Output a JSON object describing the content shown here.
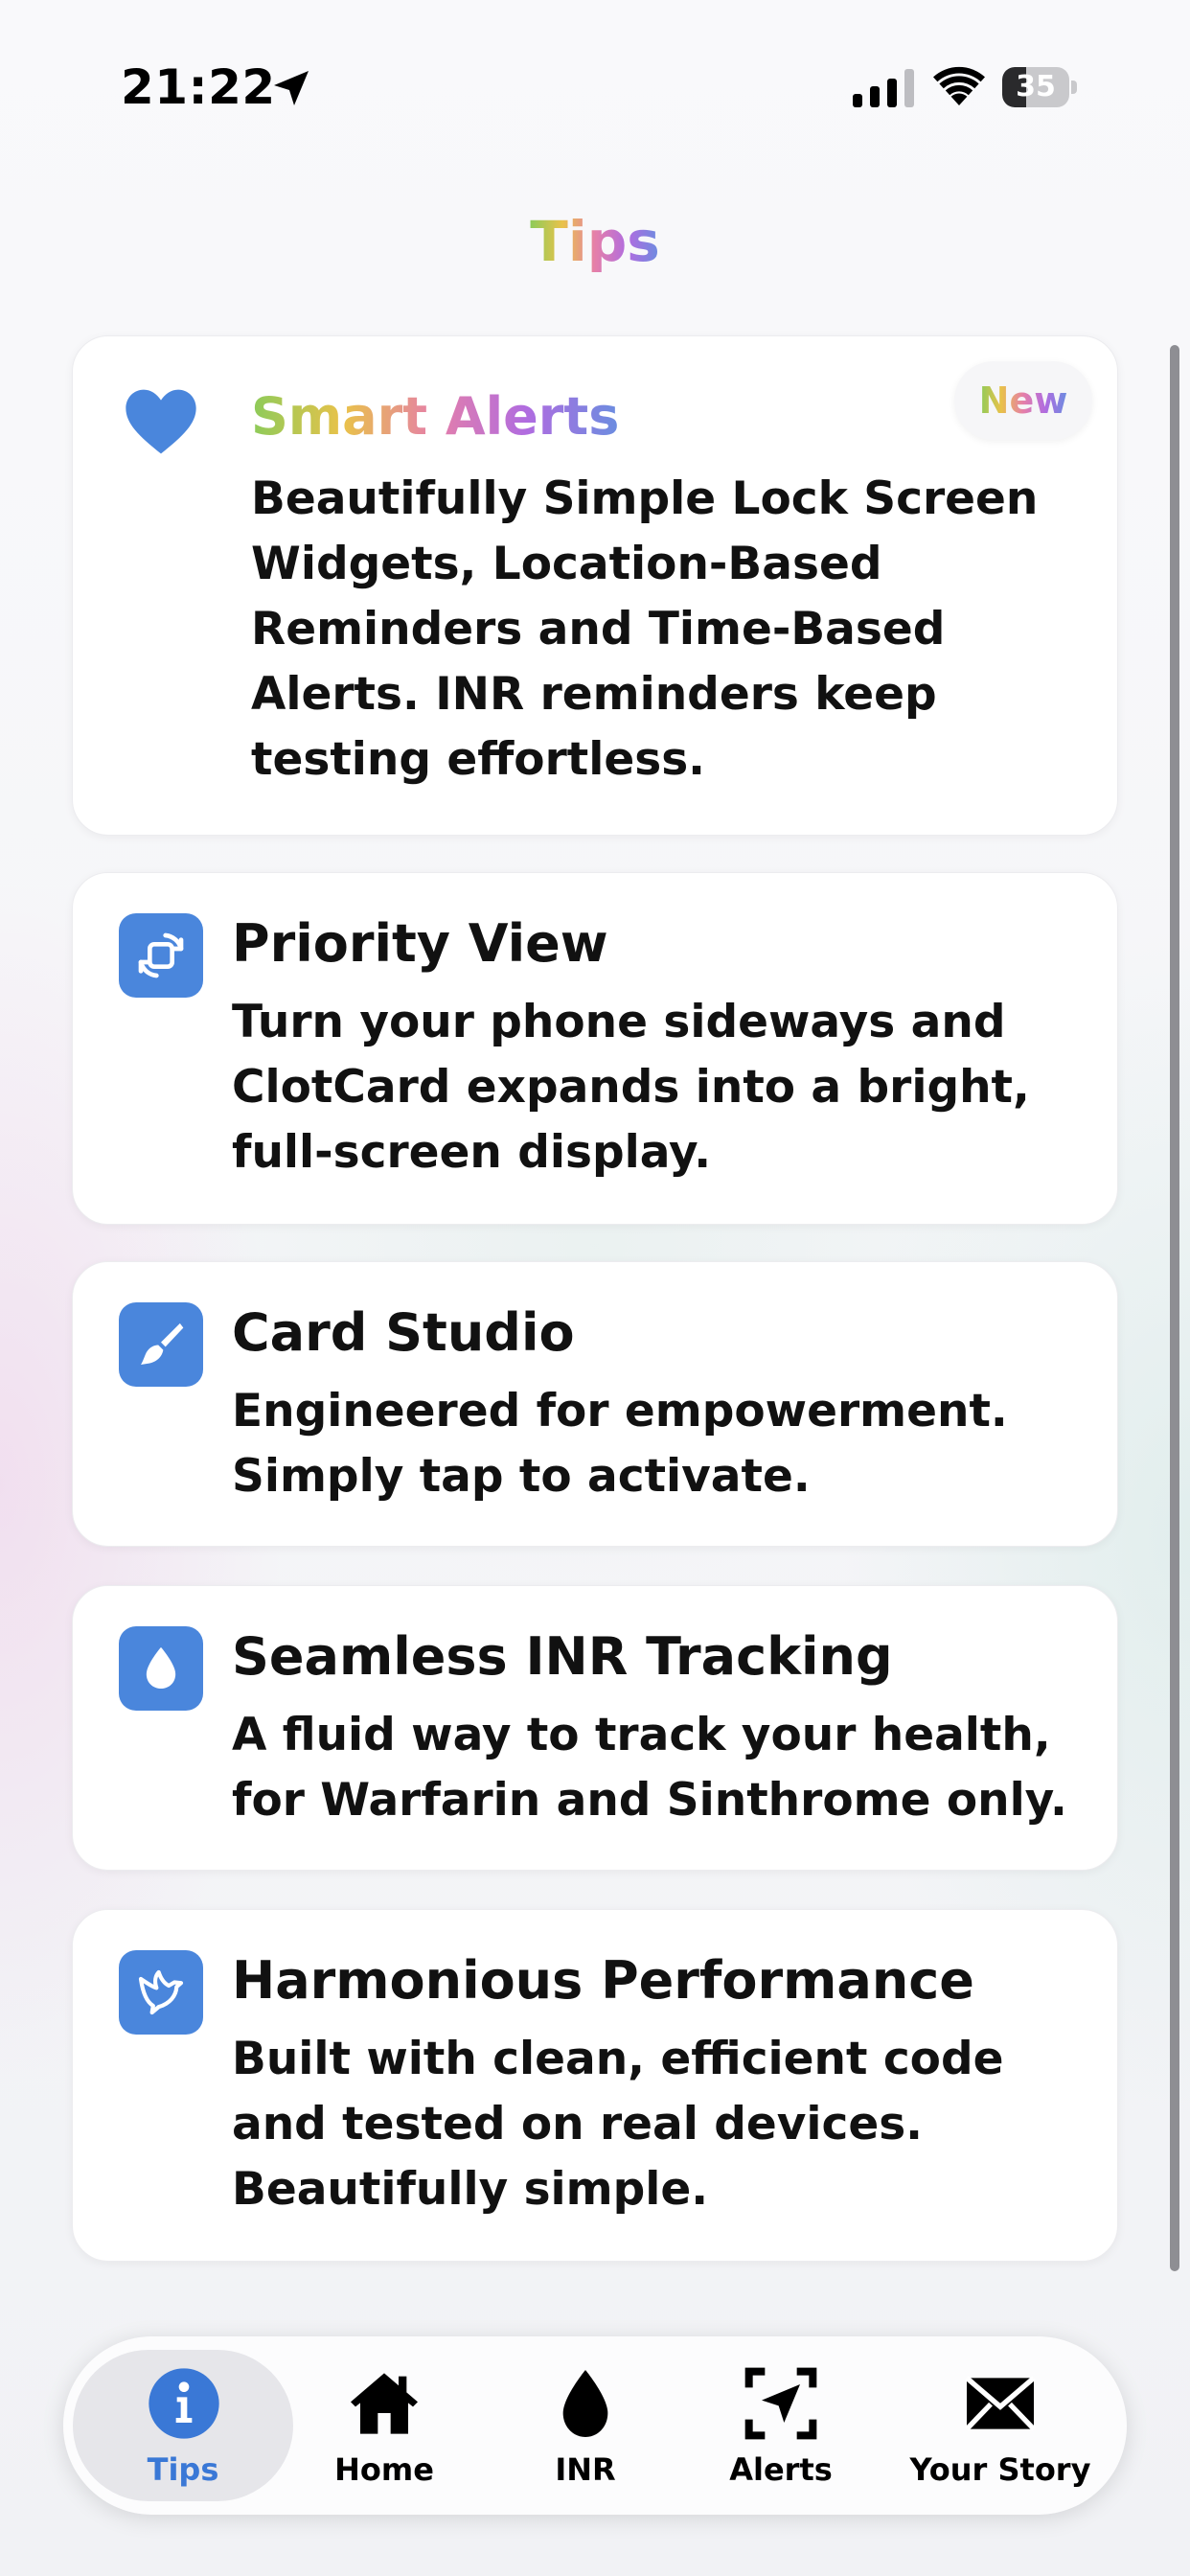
{
  "status_bar": {
    "time": "21:22",
    "battery": "35",
    "battery_level": 35
  },
  "header": {
    "title": "Tips"
  },
  "cards": [
    {
      "title": "Smart Alerts",
      "badge": "New",
      "icon": "heart-icon",
      "body": "Beautifully Simple Lock Screen Widgets, Location-Based Reminders and Time-Based Alerts. INR reminders keep testing effortless."
    },
    {
      "title": "Priority View",
      "icon": "rotate-icon",
      "body": "Turn your phone sideways and ClotCard expands into a bright, full-screen display."
    },
    {
      "title": "Card Studio",
      "icon": "paintbrush-icon",
      "body": "Engineered for empowerment. Simply tap to activate."
    },
    {
      "title": "Seamless INR Tracking",
      "icon": "drop-icon",
      "body": "A fluid way to track your health, for Warfarin and Sinthrome only."
    },
    {
      "title": "Harmonious Performance",
      "icon": "bird-icon",
      "body": "Built with clean, efficient code and tested on real devices. Beautifully simple."
    }
  ],
  "tabbar": {
    "active": "Tips",
    "active_color": "#3a78d6",
    "tabs": [
      {
        "label": "Tips",
        "icon": "info-icon"
      },
      {
        "label": "Home",
        "icon": "house-icon"
      },
      {
        "label": "INR",
        "icon": "drop-icon"
      },
      {
        "label": "Alerts",
        "icon": "location-arrow-icon"
      },
      {
        "label": "Your Story",
        "icon": "envelope-icon"
      }
    ]
  },
  "colors": {
    "accent": "#4a86dc",
    "text": "#111111"
  }
}
